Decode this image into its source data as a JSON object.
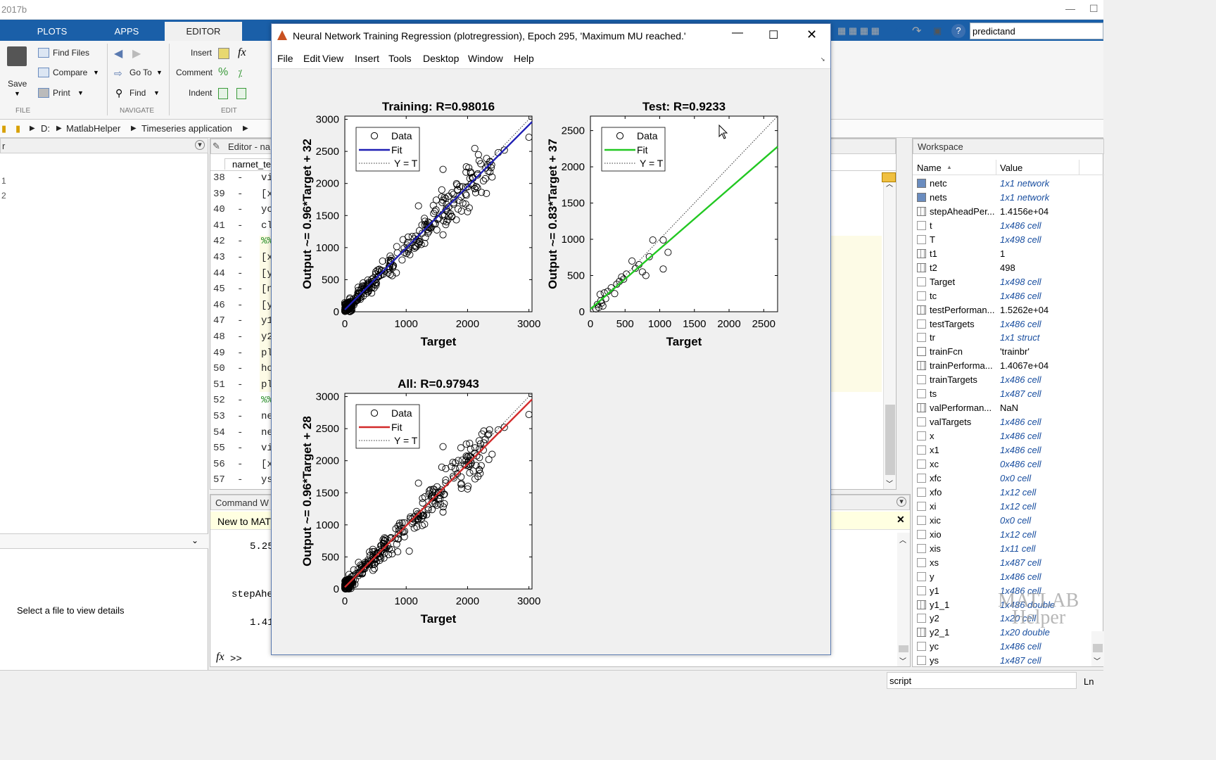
{
  "app": {
    "title_partial": "2017b",
    "window_controls": [
      "—",
      "☐"
    ]
  },
  "tabs": [
    {
      "label": "PLOTS"
    },
    {
      "label": "APPS"
    },
    {
      "label": "EDITOR"
    }
  ],
  "ribbon": {
    "save": "Save",
    "find_files": "Find Files",
    "compare": "Compare",
    "print": "Print",
    "go_to": "Go To",
    "find": "Find",
    "insert": "Insert",
    "comment": "Comment",
    "indent": "Indent",
    "groups": {
      "file": "FILE",
      "navigate": "NAVIGATE",
      "edit": "EDIT"
    }
  },
  "search": {
    "value": "predictand"
  },
  "address": {
    "drive": "D:",
    "folder1": "MatlabHelper",
    "folder2": "Timeseries application"
  },
  "left_panel": {
    "header": "r",
    "items": [
      "1",
      "2"
    ],
    "details": "Select a file to view details"
  },
  "editor": {
    "header": "Editor - na",
    "tab": "narnet_te",
    "lines": [
      {
        "n": "38",
        "code": "vi"
      },
      {
        "n": "39",
        "code": "[x"
      },
      {
        "n": "40",
        "code": "yc"
      },
      {
        "n": "41",
        "code": "cl"
      },
      {
        "n": "42",
        "code": "%%"
      },
      {
        "n": "43",
        "code": "[x"
      },
      {
        "n": "44",
        "code": "[y"
      },
      {
        "n": "45",
        "code": "[n"
      },
      {
        "n": "46",
        "code": "[y"
      },
      {
        "n": "47",
        "code": "y1"
      },
      {
        "n": "48",
        "code": "y2"
      },
      {
        "n": "49",
        "code": "pl"
      },
      {
        "n": "50",
        "code": "ho"
      },
      {
        "n": "51",
        "code": "pl"
      },
      {
        "n": "52",
        "code": "%%"
      },
      {
        "n": "53",
        "code": "ne"
      },
      {
        "n": "54",
        "code": "ne"
      },
      {
        "n": "55",
        "code": "vi"
      },
      {
        "n": "56",
        "code": "[x"
      },
      {
        "n": "57",
        "code": "ys"
      }
    ]
  },
  "command_window": {
    "header": "Command W",
    "banner": "New to MAT",
    "lines": [
      "5.25",
      "stepAhe",
      "1.41"
    ],
    "prompt": ">>",
    "fx": "fx"
  },
  "workspace": {
    "title": "Workspace",
    "col_name": "Name",
    "sort_icon": "▲",
    "col_value": "Value",
    "rows": [
      {
        "name": "netc",
        "value": "1x1 network",
        "type": "obj"
      },
      {
        "name": "nets",
        "value": "1x1 network",
        "type": "obj"
      },
      {
        "name": "stepAheadPer...",
        "value": "1.4156e+04",
        "type": "num"
      },
      {
        "name": "t",
        "value": "1x486 cell",
        "type": "cell"
      },
      {
        "name": "T",
        "value": "1x498 cell",
        "type": "cell"
      },
      {
        "name": "t1",
        "value": "1",
        "type": "num"
      },
      {
        "name": "t2",
        "value": "498",
        "type": "num"
      },
      {
        "name": "Target",
        "value": "1x498 cell",
        "type": "cell"
      },
      {
        "name": "tc",
        "value": "1x486 cell",
        "type": "cell"
      },
      {
        "name": "testPerforman...",
        "value": "1.5262e+04",
        "type": "num"
      },
      {
        "name": "testTargets",
        "value": "1x486 cell",
        "type": "cell"
      },
      {
        "name": "tr",
        "value": "1x1 struct",
        "type": "cell"
      },
      {
        "name": "trainFcn",
        "value": "'trainbr'",
        "type": "str"
      },
      {
        "name": "trainPerforma...",
        "value": "1.4067e+04",
        "type": "num"
      },
      {
        "name": "trainTargets",
        "value": "1x486 cell",
        "type": "cell"
      },
      {
        "name": "ts",
        "value": "1x487 cell",
        "type": "cell"
      },
      {
        "name": "valPerforman...",
        "value": "NaN",
        "type": "num"
      },
      {
        "name": "valTargets",
        "value": "1x486 cell",
        "type": "cell"
      },
      {
        "name": "x",
        "value": "1x486 cell",
        "type": "cell"
      },
      {
        "name": "x1",
        "value": "1x486 cell",
        "type": "cell"
      },
      {
        "name": "xc",
        "value": "0x486 cell",
        "type": "cell"
      },
      {
        "name": "xfc",
        "value": "0x0 cell",
        "type": "cell"
      },
      {
        "name": "xfo",
        "value": "1x12 cell",
        "type": "cell"
      },
      {
        "name": "xi",
        "value": "1x12 cell",
        "type": "cell"
      },
      {
        "name": "xic",
        "value": "0x0 cell",
        "type": "cell"
      },
      {
        "name": "xio",
        "value": "1x12 cell",
        "type": "cell"
      },
      {
        "name": "xis",
        "value": "1x11 cell",
        "type": "cell"
      },
      {
        "name": "xs",
        "value": "1x487 cell",
        "type": "cell"
      },
      {
        "name": "y",
        "value": "1x486 cell",
        "type": "cell"
      },
      {
        "name": "y1",
        "value": "1x486 cell",
        "type": "cell"
      },
      {
        "name": "y1_1",
        "value": "1x486 double",
        "type": "num"
      },
      {
        "name": "y2",
        "value": "1x20 cell",
        "type": "cell"
      },
      {
        "name": "y2_1",
        "value": "1x20 double",
        "type": "num"
      },
      {
        "name": "yc",
        "value": "1x486 cell",
        "type": "cell"
      },
      {
        "name": "ys",
        "value": "1x487 cell",
        "type": "cell"
      }
    ]
  },
  "status": {
    "mode": "script",
    "pos": "Ln"
  },
  "watermark": {
    "line1": "MATLAB",
    "line2": "Helper"
  },
  "figure": {
    "title": "Neural Network Training Regression (plotregression), Epoch 295, 'Maximum MU reached.'",
    "menu": [
      "File",
      "Edit",
      "View",
      "Insert",
      "Tools",
      "Desktop",
      "Window",
      "Help"
    ]
  },
  "chart_data": [
    {
      "type": "scatter",
      "title": "Training: R=0.98016",
      "xlabel": "Target",
      "ylabel": "Output ~= 0.96*Target + 32",
      "xlim": [
        0,
        3050
      ],
      "ylim": [
        0,
        3050
      ],
      "xticks": [
        0,
        1000,
        2000,
        3000
      ],
      "yticks": [
        0,
        500,
        1000,
        1500,
        2000,
        2500,
        3000
      ],
      "legend": [
        "Data",
        "Fit",
        "Y = T"
      ],
      "legend_position": "top-left",
      "fit": {
        "slope": 0.96,
        "intercept": 32,
        "color": "#1f1fb4"
      },
      "outliers": [
        [
          1600,
          2220
        ],
        [
          1980,
          2260
        ],
        [
          2050,
          2180
        ],
        [
          2400,
          2100
        ],
        [
          2600,
          2520
        ],
        [
          3000,
          2720
        ],
        [
          1580,
          1900
        ],
        [
          1200,
          1650
        ],
        [
          1900,
          1570
        ],
        [
          2000,
          1560
        ],
        [
          1600,
          1200
        ],
        [
          2500,
          2480
        ]
      ]
    },
    {
      "type": "scatter",
      "title": "Test: R=0.9233",
      "xlabel": "Target",
      "ylabel": "Output ~= 0.83*Target + 37",
      "xlim": [
        0,
        2700
      ],
      "ylim": [
        0,
        2700
      ],
      "xticks": [
        0,
        500,
        1000,
        1500,
        2000,
        2500
      ],
      "yticks": [
        0,
        500,
        1000,
        1500,
        2000,
        2500
      ],
      "legend": [
        "Data",
        "Fit",
        "Y = T"
      ],
      "legend_position": "top-left",
      "fit": {
        "slope": 0.83,
        "intercept": 37,
        "color": "#22c822"
      },
      "points": [
        [
          80,
          40
        ],
        [
          100,
          100
        ],
        [
          120,
          60
        ],
        [
          140,
          240
        ],
        [
          160,
          120
        ],
        [
          180,
          80
        ],
        [
          200,
          260
        ],
        [
          250,
          280
        ],
        [
          300,
          330
        ],
        [
          350,
          250
        ],
        [
          380,
          380
        ],
        [
          420,
          420
        ],
        [
          450,
          480
        ],
        [
          480,
          450
        ],
        [
          520,
          520
        ],
        [
          600,
          700
        ],
        [
          650,
          600
        ],
        [
          700,
          650
        ],
        [
          750,
          550
        ],
        [
          800,
          500
        ],
        [
          850,
          760
        ],
        [
          900,
          990
        ],
        [
          1050,
          990
        ],
        [
          1050,
          590
        ],
        [
          1120,
          820
        ],
        [
          150,
          150
        ],
        [
          220,
          180
        ]
      ]
    },
    {
      "type": "scatter",
      "title": "All: R=0.97943",
      "xlabel": "Target",
      "ylabel": "Output ~= 0.96*Target + 28",
      "xlim": [
        0,
        3050
      ],
      "ylim": [
        0,
        3050
      ],
      "xticks": [
        0,
        1000,
        2000,
        3000
      ],
      "yticks": [
        0,
        500,
        1000,
        1500,
        2000,
        2500,
        3000
      ],
      "legend": [
        "Data",
        "Fit",
        "Y = T"
      ],
      "legend_position": "top-left",
      "fit": {
        "slope": 0.96,
        "intercept": 28,
        "color": "#d22a2a"
      },
      "outliers": [
        [
          1600,
          2220
        ],
        [
          1980,
          2260
        ],
        [
          2050,
          2180
        ],
        [
          2400,
          2100
        ],
        [
          2600,
          2520
        ],
        [
          3000,
          2720
        ],
        [
          1580,
          1900
        ],
        [
          1200,
          1650
        ],
        [
          1900,
          1570
        ],
        [
          2000,
          1560
        ],
        [
          1600,
          1200
        ],
        [
          2500,
          2480
        ],
        [
          1050,
          590
        ],
        [
          900,
          990
        ]
      ]
    }
  ]
}
